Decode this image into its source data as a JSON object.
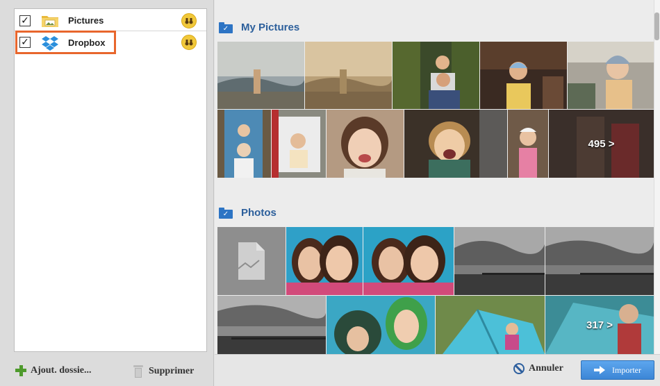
{
  "sources": [
    {
      "label": "Pictures",
      "checked": "✓",
      "icon": "pictures-folder-icon"
    },
    {
      "label": "Dropbox",
      "checked": "✓",
      "icon": "dropbox-icon"
    }
  ],
  "left_toolbar": {
    "add_label": "Ajout. dossie...",
    "remove_label": "Supprimer"
  },
  "sections": [
    {
      "title": "My Pictures",
      "more_label": "495 >"
    },
    {
      "title": "Photos",
      "more_label": "317 >"
    }
  ],
  "footer": {
    "cancel_label": "Annuler",
    "import_label": "Importer"
  },
  "colors": {
    "accent": "#2c5f9b",
    "highlight": "#e8662c",
    "import_button": "#4a96e2"
  }
}
